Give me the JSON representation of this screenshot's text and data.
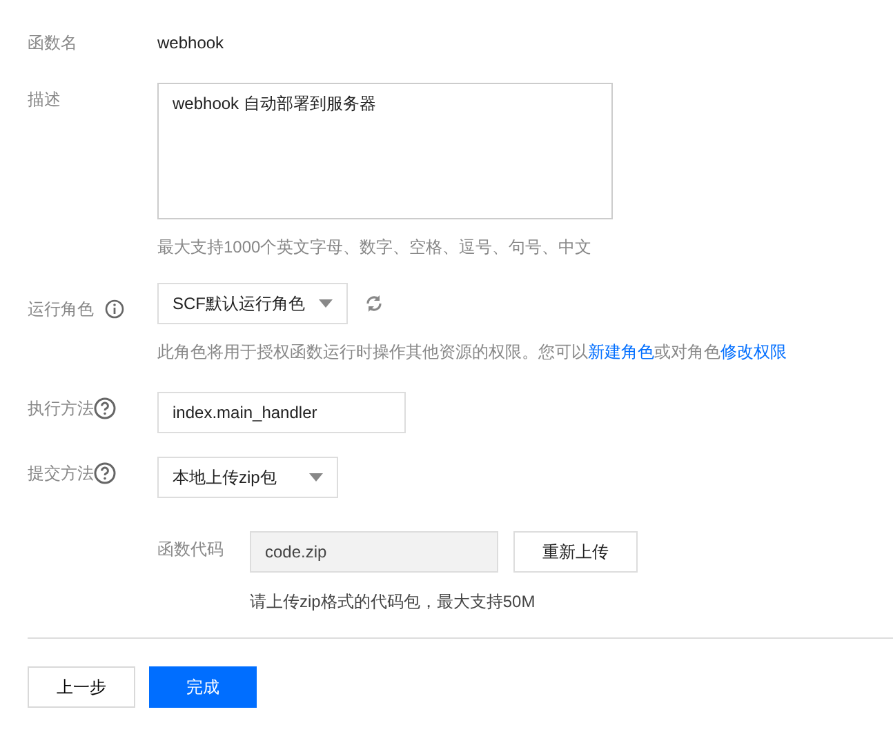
{
  "function_name": {
    "label": "函数名",
    "value": "webhook"
  },
  "description": {
    "label": "描述",
    "value": "webhook 自动部署到服务器",
    "hint": "最大支持1000个英文字母、数字、空格、逗号、句号、中文"
  },
  "role": {
    "label": "运行角色",
    "value": "SCF默认运行角色",
    "hint": [
      {
        "kind": "text",
        "text": "此角色将用于授权函数运行时操作其他资源的权限。您可以"
      },
      {
        "kind": "link",
        "text": "新建角色"
      },
      {
        "kind": "text",
        "text": "或对角色"
      },
      {
        "kind": "link",
        "text": "修改权限"
      }
    ]
  },
  "handler": {
    "label": "执行方法",
    "value": "index.main_handler"
  },
  "submit_method": {
    "label": "提交方法",
    "value": "本地上传zip包"
  },
  "code": {
    "label": "函数代码",
    "value": "code.zip",
    "button": "重新上传",
    "hint": "请上传zip格式的代码包，最大支持50M"
  },
  "buttons": [
    {
      "label": "上一步",
      "kind": "secondary"
    },
    {
      "label": "完成",
      "kind": "primary"
    }
  ]
}
